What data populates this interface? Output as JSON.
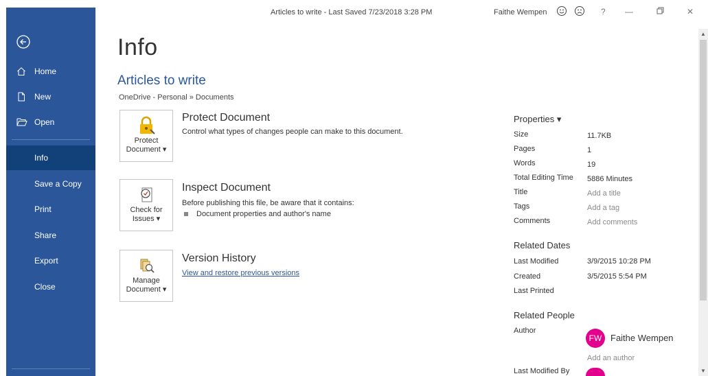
{
  "titlebar": {
    "title": "Articles to write  -  Last Saved 7/23/2018 3:28 PM",
    "user": "Faithe Wempen",
    "help": "?",
    "minimize": "—",
    "close": "✕"
  },
  "sidebar": {
    "items": [
      {
        "label": "Home",
        "icon": "home-icon"
      },
      {
        "label": "New",
        "icon": "new-document-icon"
      },
      {
        "label": "Open",
        "icon": "folder-open-icon"
      },
      {
        "label": "Info"
      },
      {
        "label": "Save a Copy"
      },
      {
        "label": "Print"
      },
      {
        "label": "Share"
      },
      {
        "label": "Export"
      },
      {
        "label": "Close"
      }
    ],
    "accent": "#2b579a",
    "active_bg": "#124078"
  },
  "main": {
    "page_title": "Info",
    "doc_title": "Articles to write",
    "doc_path": "OneDrive - Personal » Documents",
    "sections": [
      {
        "button_line1": "Protect",
        "button_line2": "Document ▾",
        "heading": "Protect Document",
        "description": "Control what types of changes people can make to this document."
      },
      {
        "button_line1": "Check for",
        "button_line2": "Issues ▾",
        "heading": "Inspect Document",
        "description": "Before publishing this file, be aware that it contains:",
        "bullet": "Document properties and author's name"
      },
      {
        "button_line1": "Manage",
        "button_line2": "Document ▾",
        "heading": "Version History",
        "link": "View and restore previous versions"
      }
    ]
  },
  "properties": {
    "heading": "Properties ▾",
    "rows": [
      {
        "label": "Size",
        "value": "11.7KB"
      },
      {
        "label": "Pages",
        "value": "1"
      },
      {
        "label": "Words",
        "value": "19"
      },
      {
        "label": "Total Editing Time",
        "value": "5886 Minutes"
      },
      {
        "label": "Title",
        "value": "Add a title"
      },
      {
        "label": "Tags",
        "value": "Add a tag"
      },
      {
        "label": "Comments",
        "value": "Add comments"
      }
    ],
    "related_dates": {
      "heading": "Related Dates",
      "rows": [
        {
          "label": "Last Modified",
          "value": "3/9/2015 10:28 PM"
        },
        {
          "label": "Created",
          "value": "3/5/2015 5:54 PM"
        },
        {
          "label": "Last Printed",
          "value": ""
        }
      ]
    },
    "related_people": {
      "heading": "Related People",
      "author_label": "Author",
      "author_initials": "FW",
      "author_name": "Faithe Wempen",
      "add_author": "Add an author",
      "last_modified_by_label": "Last Modified By"
    }
  }
}
